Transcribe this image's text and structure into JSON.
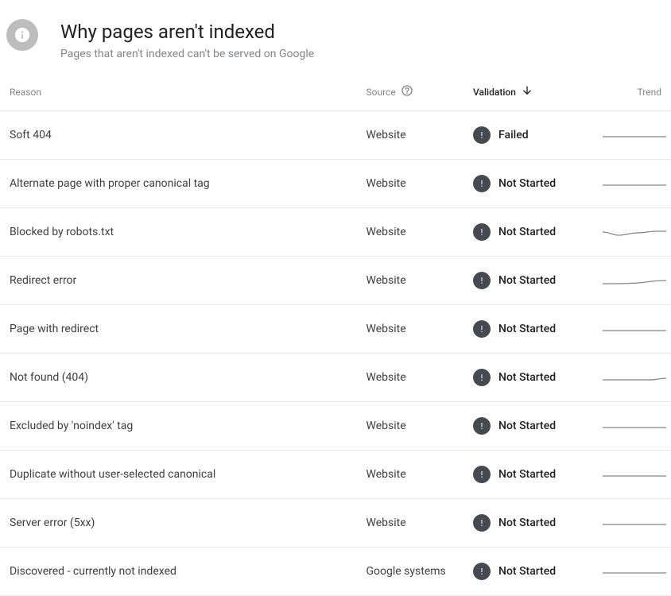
{
  "header": {
    "title": "Why pages aren't indexed",
    "subtitle": "Pages that aren't indexed can't be served on Google"
  },
  "columns": {
    "reason": "Reason",
    "source": "Source",
    "validation": "Validation",
    "trend": "Trend"
  },
  "validation_labels": {
    "failed": "Failed",
    "not_started": "Not Started"
  },
  "rows": [
    {
      "reason": "Soft 404",
      "source": "Website",
      "validation": "Failed",
      "trend": "flat"
    },
    {
      "reason": "Alternate page with proper canonical tag",
      "source": "Website",
      "validation": "Not Started",
      "trend": "flat"
    },
    {
      "reason": "Blocked by robots.txt",
      "source": "Website",
      "validation": "Not Started",
      "trend": "wavy"
    },
    {
      "reason": "Redirect error",
      "source": "Website",
      "validation": "Not Started",
      "trend": "rise"
    },
    {
      "reason": "Page with redirect",
      "source": "Website",
      "validation": "Not Started",
      "trend": "flat"
    },
    {
      "reason": "Not found (404)",
      "source": "Website",
      "validation": "Not Started",
      "trend": "slight"
    },
    {
      "reason": "Excluded by 'noindex' tag",
      "source": "Website",
      "validation": "Not Started",
      "trend": "flat"
    },
    {
      "reason": "Duplicate without user-selected canonical",
      "source": "Website",
      "validation": "Not Started",
      "trend": "flat"
    },
    {
      "reason": "Server error (5xx)",
      "source": "Website",
      "validation": "Not Started",
      "trend": "flat"
    },
    {
      "reason": "Discovered - currently not indexed",
      "source": "Google systems",
      "validation": "Not Started",
      "trend": "flat"
    }
  ]
}
